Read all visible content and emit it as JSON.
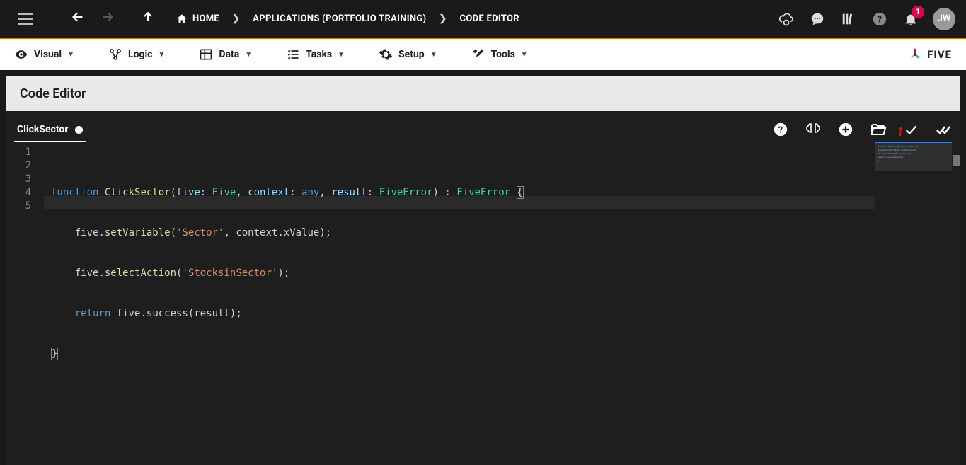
{
  "header": {
    "home_label": "HOME",
    "crumb_applications": "APPLICATIONS (PORTFOLIO TRAINING)",
    "crumb_code_editor": "CODE EDITOR",
    "notification_count": "1",
    "avatar_initials": "JW"
  },
  "toolbar": {
    "visual": "Visual",
    "logic": "Logic",
    "data": "Data",
    "tasks": "Tasks",
    "setup": "Setup",
    "tools": "Tools",
    "brand": "FIVE"
  },
  "page": {
    "title": "Code Editor"
  },
  "editor": {
    "tab_name": "ClickSector",
    "line_numbers": [
      "1",
      "2",
      "3",
      "4",
      "5"
    ],
    "code": {
      "l1": {
        "kw_function": "function",
        "fname": "ClickSector",
        "p1": "five",
        "t1": "Five",
        "p2": "context",
        "t2": "any",
        "p3": "result",
        "t3": "FiveError",
        "ret": "FiveError"
      },
      "l2": {
        "obj": "five",
        "method": "setVariable",
        "arg1": "'Sector'",
        "arg2_obj": "context",
        "arg2_prop": "xValue"
      },
      "l3": {
        "obj": "five",
        "method": "selectAction",
        "arg1": "'StocksinSector'"
      },
      "l4": {
        "kw_return": "return",
        "obj": "five",
        "method": "success",
        "arg": "result"
      },
      "l5": {
        "close": "}"
      }
    }
  }
}
